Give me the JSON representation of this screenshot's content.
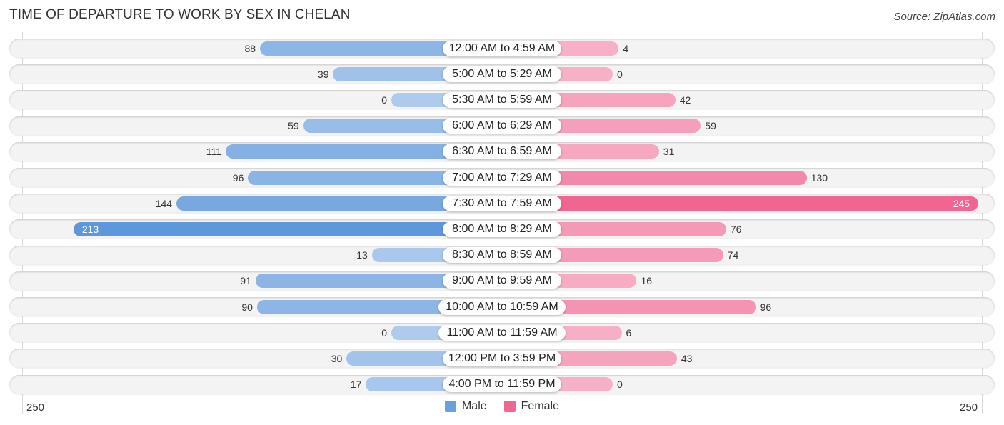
{
  "chart_data": {
    "type": "bar",
    "orientation": "horizontal-diverging",
    "title": "TIME OF DEPARTURE TO WORK BY SEX IN CHELAN",
    "source": "Source: ZipAtlas.com",
    "categories": [
      "12:00 AM to 4:59 AM",
      "5:00 AM to 5:29 AM",
      "5:30 AM to 5:59 AM",
      "6:00 AM to 6:29 AM",
      "6:30 AM to 6:59 AM",
      "7:00 AM to 7:29 AM",
      "7:30 AM to 7:59 AM",
      "8:00 AM to 8:29 AM",
      "8:30 AM to 8:59 AM",
      "9:00 AM to 9:59 AM",
      "10:00 AM to 10:59 AM",
      "11:00 AM to 11:59 AM",
      "12:00 PM to 3:59 PM",
      "4:00 PM to 11:59 PM"
    ],
    "series": [
      {
        "name": "Male",
        "color": "#6a9fdc",
        "side": "left",
        "values": [
          88,
          39,
          0,
          59,
          111,
          96,
          144,
          213,
          13,
          91,
          90,
          0,
          30,
          17
        ]
      },
      {
        "name": "Female",
        "color": "#f06892",
        "side": "right",
        "values": [
          4,
          0,
          42,
          59,
          31,
          130,
          245,
          76,
          74,
          16,
          96,
          6,
          43,
          0
        ]
      }
    ],
    "axis": {
      "left_tick": "250",
      "right_tick": "250",
      "range": [
        0,
        250
      ]
    },
    "legend": {
      "position": "bottom-center",
      "items": [
        "Male",
        "Female"
      ]
    },
    "grid": false
  }
}
